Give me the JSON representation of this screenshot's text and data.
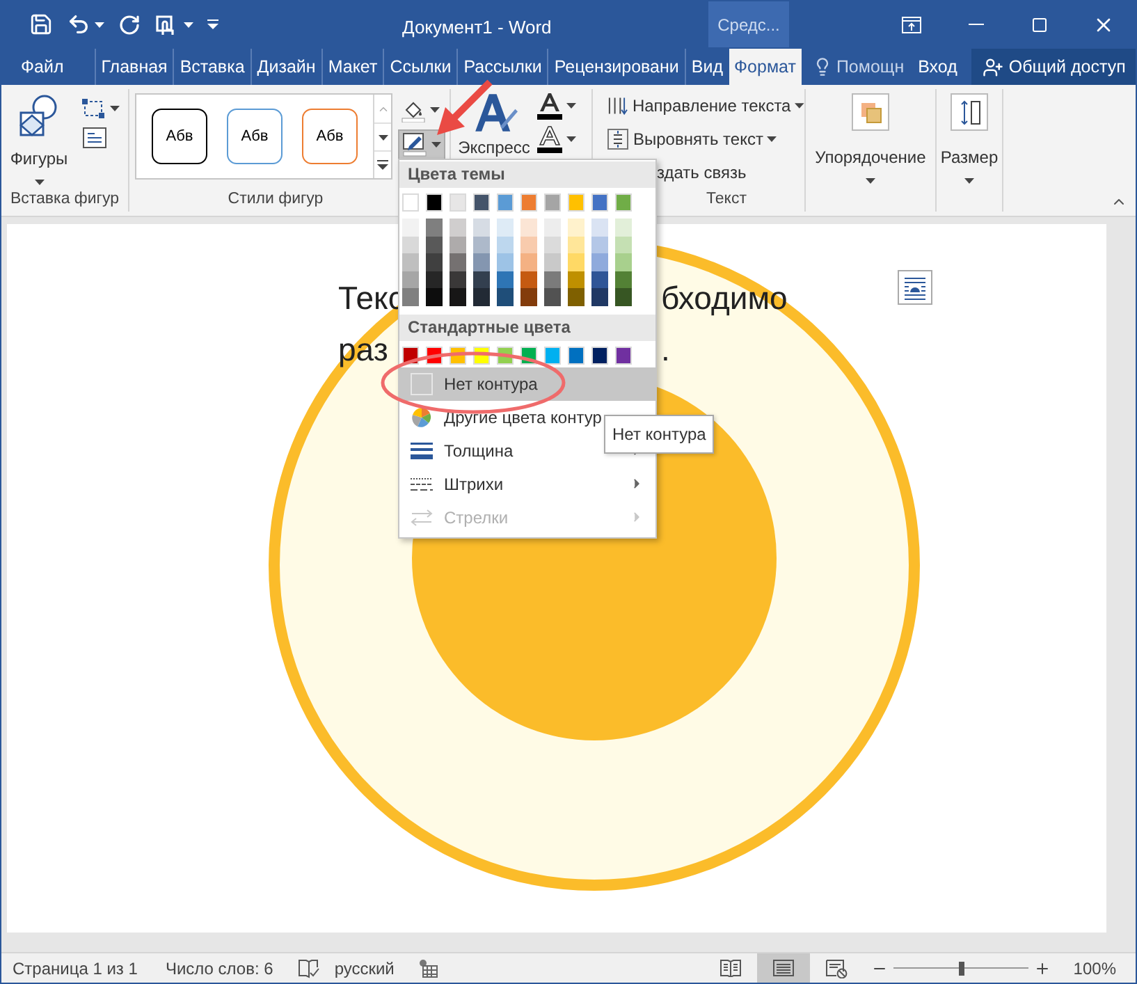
{
  "title_bar": {
    "title": "Документ1 - Word",
    "context_tab": "Средс..."
  },
  "tabs": [
    {
      "label": "Файл",
      "selected": false
    },
    {
      "label": "Главная",
      "selected": false
    },
    {
      "label": "Вставка",
      "selected": false
    },
    {
      "label": "Дизайн",
      "selected": false
    },
    {
      "label": "Макет",
      "selected": false
    },
    {
      "label": "Ссылки",
      "selected": false
    },
    {
      "label": "Рассылки",
      "selected": false
    },
    {
      "label": "Рецензировани",
      "selected": false
    },
    {
      "label": "Вид",
      "selected": false
    },
    {
      "label": "Формат",
      "selected": true
    }
  ],
  "tell_me": "Помощн",
  "sign_in": "Вход",
  "share": "Общий доступ",
  "ribbon": {
    "insert_shapes": {
      "button": "Фигуры",
      "label": "Вставка фигур"
    },
    "shape_styles": {
      "gallery": [
        {
          "label": "Абв",
          "color": "#000000"
        },
        {
          "label": "Абв",
          "color": "#5b9bd5"
        },
        {
          "label": "Абв",
          "color": "#ed7d31"
        }
      ],
      "label": "Стили фигур"
    },
    "wordart": {
      "button": "Экспресс"
    },
    "text": {
      "items": [
        {
          "label": "Направление текста",
          "kind": "direction"
        },
        {
          "label": "Выровнять текст",
          "kind": "align"
        },
        {
          "label": "здать связь",
          "kind": "link"
        }
      ],
      "label": "Текст"
    },
    "arrange": "Упорядочение",
    "size": "Размер"
  },
  "outline_menu": {
    "theme_header": "Цвета темы",
    "theme_colors": [
      {
        "color": "#ffffff",
        "shades": [
          {
            "color": "#f2f2f2"
          },
          {
            "color": "#d9d9d9"
          },
          {
            "color": "#bfbfbf"
          },
          {
            "color": "#a6a6a6"
          },
          {
            "color": "#808080"
          }
        ]
      },
      {
        "color": "#000000",
        "shades": [
          {
            "color": "#7f7f7f"
          },
          {
            "color": "#595959"
          },
          {
            "color": "#404040"
          },
          {
            "color": "#262626"
          },
          {
            "color": "#0d0d0d"
          }
        ]
      },
      {
        "color": "#e7e6e6",
        "shades": [
          {
            "color": "#d0cece"
          },
          {
            "color": "#aeabab"
          },
          {
            "color": "#757171"
          },
          {
            "color": "#3a3838"
          },
          {
            "color": "#171616"
          }
        ]
      },
      {
        "color": "#44546a",
        "shades": [
          {
            "color": "#d6dce4"
          },
          {
            "color": "#adb9ca"
          },
          {
            "color": "#8496b0"
          },
          {
            "color": "#333f4f"
          },
          {
            "color": "#222a35"
          }
        ]
      },
      {
        "color": "#5b9bd5",
        "shades": [
          {
            "color": "#deebf6"
          },
          {
            "color": "#bdd7ee"
          },
          {
            "color": "#9dc3e6"
          },
          {
            "color": "#2e75b5"
          },
          {
            "color": "#1f4e79"
          }
        ]
      },
      {
        "color": "#ed7d31",
        "shades": [
          {
            "color": "#fbe5d5"
          },
          {
            "color": "#f8cbad"
          },
          {
            "color": "#f4b183"
          },
          {
            "color": "#c55a11"
          },
          {
            "color": "#833c0b"
          }
        ]
      },
      {
        "color": "#a5a5a5",
        "shades": [
          {
            "color": "#ededed"
          },
          {
            "color": "#dbdbdb"
          },
          {
            "color": "#c9c9c9"
          },
          {
            "color": "#7b7b7b"
          },
          {
            "color": "#525252"
          }
        ]
      },
      {
        "color": "#ffc000",
        "shades": [
          {
            "color": "#fff2cc"
          },
          {
            "color": "#ffe699"
          },
          {
            "color": "#ffd965"
          },
          {
            "color": "#bf9000"
          },
          {
            "color": "#7f6000"
          }
        ]
      },
      {
        "color": "#4472c4",
        "shades": [
          {
            "color": "#dae3f3"
          },
          {
            "color": "#b4c7e7"
          },
          {
            "color": "#8faadc"
          },
          {
            "color": "#2f5597"
          },
          {
            "color": "#203864"
          }
        ]
      },
      {
        "color": "#70ad47",
        "shades": [
          {
            "color": "#e2efd9"
          },
          {
            "color": "#c5e0b3"
          },
          {
            "color": "#a8d08d"
          },
          {
            "color": "#538135"
          },
          {
            "color": "#375623"
          }
        ]
      }
    ],
    "standard_header": "Стандартные цвета",
    "standard_colors": [
      {
        "color": "#c00000"
      },
      {
        "color": "#ff0000"
      },
      {
        "color": "#ffc000"
      },
      {
        "color": "#ffff00"
      },
      {
        "color": "#92d050"
      },
      {
        "color": "#00b050"
      },
      {
        "color": "#00b0f0"
      },
      {
        "color": "#0070c0"
      },
      {
        "color": "#002060"
      },
      {
        "color": "#7030a0"
      }
    ],
    "items": [
      {
        "label": "Нет контура",
        "kind": "none",
        "selected": true,
        "submenu": false,
        "disabled": false
      },
      {
        "label": "Другие цвета контур",
        "kind": "more",
        "selected": false,
        "submenu": false,
        "disabled": false
      },
      {
        "label": "Толщина",
        "kind": "weight",
        "selected": false,
        "submenu": true,
        "disabled": false
      },
      {
        "label": "Штрихи",
        "kind": "dashes",
        "selected": false,
        "submenu": true,
        "disabled": false
      },
      {
        "label": "Стрелки",
        "kind": "arrows",
        "selected": false,
        "submenu": true,
        "disabled": true
      }
    ]
  },
  "tooltip": "Нет контура",
  "document": {
    "lines": [
      {
        "before": "Текс",
        "after": "бходимо"
      },
      {
        "before": "раз",
        "after": "."
      }
    ]
  },
  "status_bar": {
    "page": "Страница 1 из 1",
    "words": "Число слов: 6",
    "language": "русский",
    "views": [
      {
        "kind": "read",
        "selected": false
      },
      {
        "kind": "print",
        "selected": true
      },
      {
        "kind": "web",
        "selected": false
      }
    ],
    "zoom": {
      "level": 0.5,
      "reading": "100%"
    }
  }
}
